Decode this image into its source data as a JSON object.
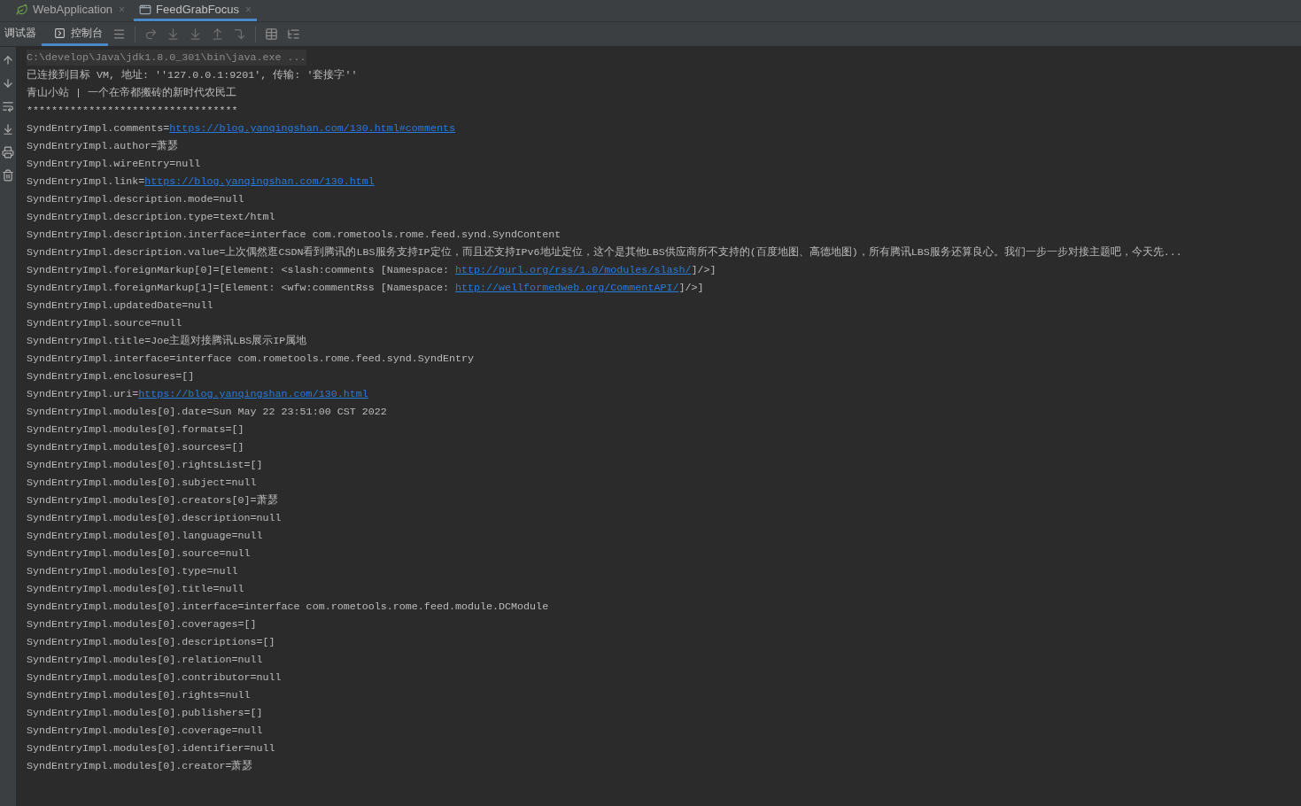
{
  "editor_tabs": [
    {
      "label": "WebApplication",
      "selected": false,
      "kind": "spring",
      "close": "×"
    },
    {
      "label": "FeedGrabFocus",
      "selected": true,
      "kind": "app",
      "close": "×"
    }
  ],
  "tool_tabs": [
    {
      "label": "调试器",
      "selected": false,
      "kind": "plain"
    },
    {
      "label": "控制台",
      "selected": true,
      "kind": "console"
    }
  ],
  "console_lines": [
    [
      {
        "kind": "command",
        "text": "C:\\develop\\Java\\jdk1.8.0_301\\bin\\java.exe ..."
      }
    ],
    [
      {
        "kind": "text",
        "text": "已连接到目标 VM, 地址: ''127.0.0.1:9201', 传输: '套接字''"
      }
    ],
    [
      {
        "kind": "text",
        "text": "青山小站 | 一个在帝都搬砖的新时代农民工"
      }
    ],
    [
      {
        "kind": "text",
        "text": "**********************************"
      }
    ],
    [
      {
        "kind": "text",
        "text": "SyndEntryImpl.comments="
      },
      {
        "kind": "link",
        "text": "https://blog.yanqingshan.com/130.html#comments"
      }
    ],
    [
      {
        "kind": "text",
        "text": "SyndEntryImpl.author=萧瑟"
      }
    ],
    [
      {
        "kind": "text",
        "text": "SyndEntryImpl.wireEntry=null"
      }
    ],
    [
      {
        "kind": "text",
        "text": "SyndEntryImpl.link="
      },
      {
        "kind": "link",
        "text": "https://blog.yanqingshan.com/130.html"
      }
    ],
    [
      {
        "kind": "text",
        "text": "SyndEntryImpl.description.mode=null"
      }
    ],
    [
      {
        "kind": "text",
        "text": "SyndEntryImpl.description.type=text/html"
      }
    ],
    [
      {
        "kind": "text",
        "text": "SyndEntryImpl.description.interface=interface com.rometools.rome.feed.synd.SyndContent"
      }
    ],
    [
      {
        "kind": "text",
        "text": "SyndEntryImpl.description.value=上次偶然逛CSDN看到腾讯的LBS服务支持IP定位，而且还支持IPv6地址定位，这个是其他LBS供应商所不支持的(百度地图、高德地图)，所有腾讯LBS服务还算良心。我们一步一步对接主题吧，今天先..."
      }
    ],
    [
      {
        "kind": "text",
        "text": "SyndEntryImpl.foreignMarkup[0]=[Element: <slash:comments [Namespace: "
      },
      {
        "kind": "link",
        "text": "http://purl.org/rss/1.0/modules/slash/"
      },
      {
        "kind": "text",
        "text": "]/>]"
      }
    ],
    [
      {
        "kind": "text",
        "text": "SyndEntryImpl.foreignMarkup[1]=[Element: <wfw:commentRss [Namespace: "
      },
      {
        "kind": "link",
        "text": "http://wellformedweb.org/CommentAPI/"
      },
      {
        "kind": "text",
        "text": "]/>]"
      }
    ],
    [
      {
        "kind": "text",
        "text": "SyndEntryImpl.updatedDate=null"
      }
    ],
    [
      {
        "kind": "text",
        "text": "SyndEntryImpl.source=null"
      }
    ],
    [
      {
        "kind": "text",
        "text": "SyndEntryImpl.title=Joe主题对接腾讯LBS展示IP属地"
      }
    ],
    [
      {
        "kind": "text",
        "text": "SyndEntryImpl.interface=interface com.rometools.rome.feed.synd.SyndEntry"
      }
    ],
    [
      {
        "kind": "text",
        "text": "SyndEntryImpl.enclosures=[]"
      }
    ],
    [
      {
        "kind": "text",
        "text": "SyndEntryImpl.uri="
      },
      {
        "kind": "link",
        "text": "https://blog.yanqingshan.com/130.html"
      }
    ],
    [
      {
        "kind": "text",
        "text": "SyndEntryImpl.modules[0].date=Sun May 22 23:51:00 CST 2022"
      }
    ],
    [
      {
        "kind": "text",
        "text": "SyndEntryImpl.modules[0].formats=[]"
      }
    ],
    [
      {
        "kind": "text",
        "text": "SyndEntryImpl.modules[0].sources=[]"
      }
    ],
    [
      {
        "kind": "text",
        "text": "SyndEntryImpl.modules[0].rightsList=[]"
      }
    ],
    [
      {
        "kind": "text",
        "text": "SyndEntryImpl.modules[0].subject=null"
      }
    ],
    [
      {
        "kind": "text",
        "text": "SyndEntryImpl.modules[0].creators[0]=萧瑟"
      }
    ],
    [
      {
        "kind": "text",
        "text": "SyndEntryImpl.modules[0].description=null"
      }
    ],
    [
      {
        "kind": "text",
        "text": "SyndEntryImpl.modules[0].language=null"
      }
    ],
    [
      {
        "kind": "text",
        "text": "SyndEntryImpl.modules[0].source=null"
      }
    ],
    [
      {
        "kind": "text",
        "text": "SyndEntryImpl.modules[0].type=null"
      }
    ],
    [
      {
        "kind": "text",
        "text": "SyndEntryImpl.modules[0].title=null"
      }
    ],
    [
      {
        "kind": "text",
        "text": "SyndEntryImpl.modules[0].interface=interface com.rometools.rome.feed.module.DCModule"
      }
    ],
    [
      {
        "kind": "text",
        "text": "SyndEntryImpl.modules[0].coverages=[]"
      }
    ],
    [
      {
        "kind": "text",
        "text": "SyndEntryImpl.modules[0].descriptions=[]"
      }
    ],
    [
      {
        "kind": "text",
        "text": "SyndEntryImpl.modules[0].relation=null"
      }
    ],
    [
      {
        "kind": "text",
        "text": "SyndEntryImpl.modules[0].contributor=null"
      }
    ],
    [
      {
        "kind": "text",
        "text": "SyndEntryImpl.modules[0].rights=null"
      }
    ],
    [
      {
        "kind": "text",
        "text": "SyndEntryImpl.modules[0].publishers=[]"
      }
    ],
    [
      {
        "kind": "text",
        "text": "SyndEntryImpl.modules[0].coverage=null"
      }
    ],
    [
      {
        "kind": "text",
        "text": "SyndEntryImpl.modules[0].identifier=null"
      }
    ],
    [
      {
        "kind": "text",
        "text": "SyndEntryImpl.modules[0].creator=萧瑟"
      }
    ]
  ]
}
